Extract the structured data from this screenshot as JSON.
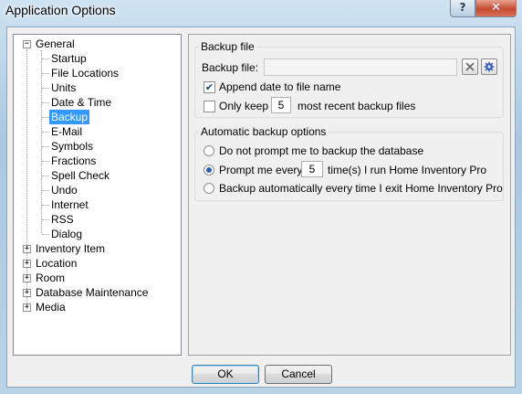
{
  "window": {
    "title": "Application Options",
    "help_label": "?",
    "close_label": "✕"
  },
  "tree": {
    "general": "General",
    "general_children": [
      "Startup",
      "File Locations",
      "Units",
      "Date & Time",
      "Backup",
      "E-Mail",
      "Symbols",
      "Fractions",
      "Spell Check",
      "Undo",
      "Internet",
      "RSS",
      "Dialog"
    ],
    "selected": "Backup",
    "collapsed": [
      "Inventory Item",
      "Location",
      "Room",
      "Database Maintenance",
      "Media"
    ],
    "expanded_sign": "−",
    "collapsed_sign": "+"
  },
  "backup_file": {
    "group_title": "Backup file",
    "label": "Backup file:",
    "value": "",
    "clear_icon": "clear-x-icon",
    "browse_icon": "browse-gear-icon",
    "append_date_label": "Append date to file name",
    "append_date_checked": true,
    "only_keep_label": "Only keep",
    "only_keep_checked": false,
    "keep_count": "5",
    "keep_suffix": "most recent backup files"
  },
  "auto_backup": {
    "group_title": "Automatic backup options",
    "option1": "Do not prompt me to backup the database",
    "option2_prefix": "Prompt me every",
    "option2_count": "5",
    "option2_suffix": "time(s) I run Home Inventory Pro",
    "option3": "Backup automatically every time I exit Home Inventory Pro",
    "selected_option": 2
  },
  "buttons": {
    "ok": "OK",
    "cancel": "Cancel"
  }
}
